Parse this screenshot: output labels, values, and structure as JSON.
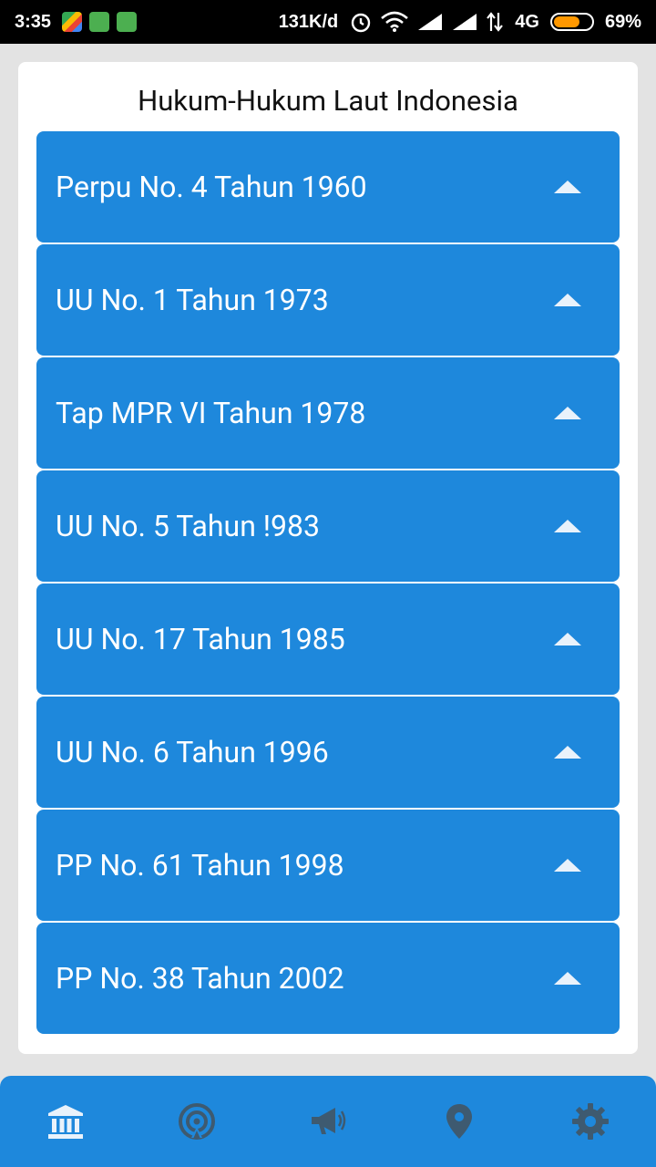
{
  "status_bar": {
    "time": "3:35",
    "network_speed": "131K/d",
    "network_type": "4G",
    "battery_percent": "69%",
    "battery_level": 0.69
  },
  "page_title": "Hukum-Hukum Laut Indonesia",
  "laws": [
    {
      "label": "Perpu No. 4 Tahun 1960"
    },
    {
      "label": "UU No. 1 Tahun 1973"
    },
    {
      "label": "Tap MPR VI Tahun 1978"
    },
    {
      "label": "UU No. 5 Tahun !983"
    },
    {
      "label": "UU No. 17 Tahun 1985"
    },
    {
      "label": "UU No. 6 Tahun 1996"
    },
    {
      "label": "PP No. 61 Tahun 1998"
    },
    {
      "label": "PP No. 38 Tahun 2002"
    }
  ],
  "bottom_nav": [
    {
      "icon": "bank-icon",
      "active": true
    },
    {
      "icon": "broadcast-icon",
      "active": false
    },
    {
      "icon": "megaphone-icon",
      "active": false
    },
    {
      "icon": "map-pin-icon",
      "active": false
    },
    {
      "icon": "gear-icon",
      "active": false
    }
  ],
  "colors": {
    "accent": "#1e88dc",
    "nav_active": "#e9f2fb",
    "nav_inactive": "#3e5a70"
  }
}
